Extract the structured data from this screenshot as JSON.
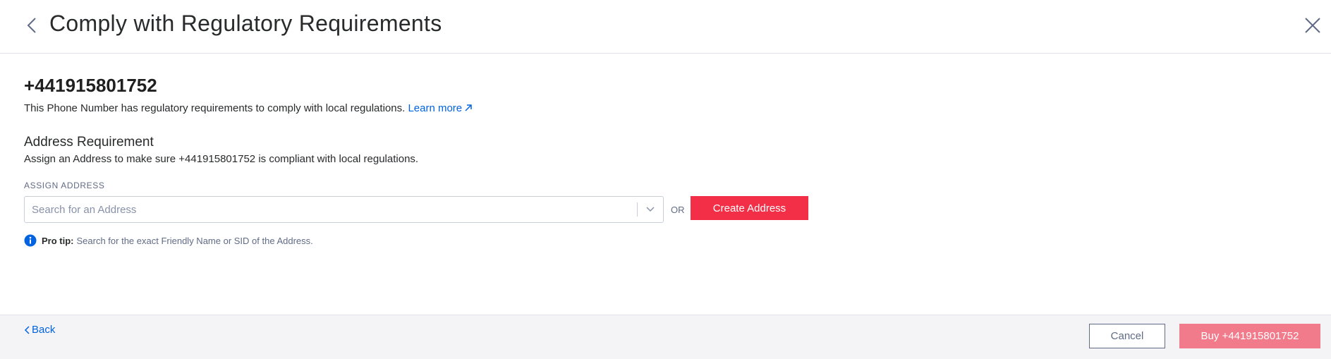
{
  "header": {
    "title": "Comply with Regulatory Requirements",
    "back_icon": "chevron-left-icon",
    "close_icon": "close-icon"
  },
  "phone_number": "+441915801752",
  "description": {
    "text": "This Phone Number has regulatory requirements to comply with local regulations. ",
    "learn_more": "Learn more"
  },
  "address_requirement": {
    "title": "Address Requirement",
    "description": "Assign an Address to make sure +441915801752 is compliant with local regulations.",
    "field_label": "ASSIGN ADDRESS",
    "search_placeholder": "Search for an Address",
    "search_value": "",
    "or_label": "OR",
    "create_button": "Create Address"
  },
  "pro_tip": {
    "label": "Pro tip:",
    "text": "Search for the exact Friendly Name or SID of the Address."
  },
  "footer": {
    "back_label": "Back",
    "cancel_label": "Cancel",
    "buy_label": "Buy +441915801752"
  },
  "colors": {
    "accent_red": "#f22f46",
    "disabled_red": "#f27b8b",
    "link_blue": "#0263e0",
    "info_blue": "#0263e0"
  }
}
